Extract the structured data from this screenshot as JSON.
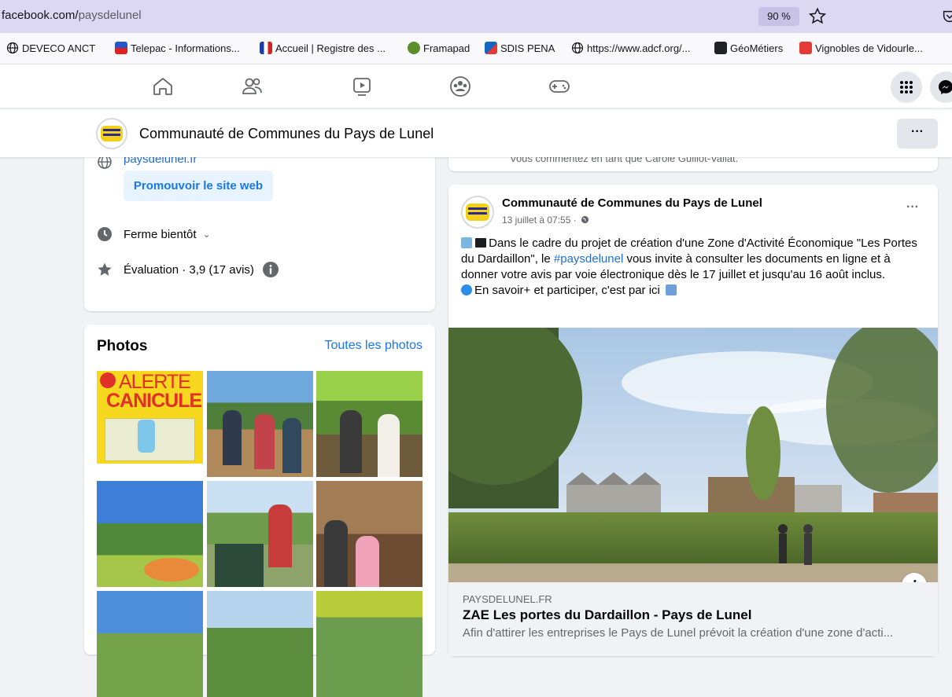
{
  "browser": {
    "url_domain": "facebook.com/",
    "url_path": "paysdelunel",
    "zoom": "90 %"
  },
  "bookmarks": [
    {
      "label": "DEVECO ANCT",
      "icon": "globe-icon"
    },
    {
      "label": "Telepac - Informations...",
      "icon": "telepac-icon"
    },
    {
      "label": "Accueil | Registre des ...",
      "icon": "registre-icon"
    },
    {
      "label": "Framapad",
      "icon": "framapad-icon"
    },
    {
      "label": "SDIS PENA",
      "icon": "sdis-icon"
    },
    {
      "label": "https://www.adcf.org/...",
      "icon": "globe-icon"
    },
    {
      "label": "GéoMétiers",
      "icon": "geometiers-icon"
    },
    {
      "label": "Vignobles de Vidourle...",
      "icon": "vignobles-icon"
    }
  ],
  "page": {
    "name": "Communauté de Communes du Pays de Lunel",
    "more": "···"
  },
  "intro": {
    "website": "paysdelunel.fr",
    "promote": "Promouvoir le site web",
    "hours": "Ferme bientôt",
    "rating": "Évaluation · 3,9 (17 avis)"
  },
  "photos": {
    "title": "Photos",
    "see_all": "Toutes les photos",
    "alert_line1": "ALERTE",
    "alert_line2": "CANICULE"
  },
  "previous_post": {
    "comment_hint": "Vous commentez en tant que Carole Guillot-Vallat."
  },
  "post": {
    "author": "Communauté de Communes du Pays de Lunel",
    "date": "13 juillet à 07:55 ·",
    "text_a": "Dans le cadre du projet de création d'une Zone d'Activité Économique \"Les Portes du Dardaillon\", le ",
    "hashtag": "#paysdelunel",
    "text_b": " vous invite à consulter les documents en ligne et à donner votre avis par voie électronique dès le 17 juillet et jusqu'au 16 août inclus.",
    "text_c": "En savoir+ et participer, c'est par ici",
    "link_domain": "PAYSDELUNEL.FR",
    "link_title": "ZAE Les portes du Dardaillon - Pays de Lunel",
    "link_desc": "Afin d'attirer les entreprises le Pays de Lunel prévoit la création d'une zone d'acti..."
  }
}
